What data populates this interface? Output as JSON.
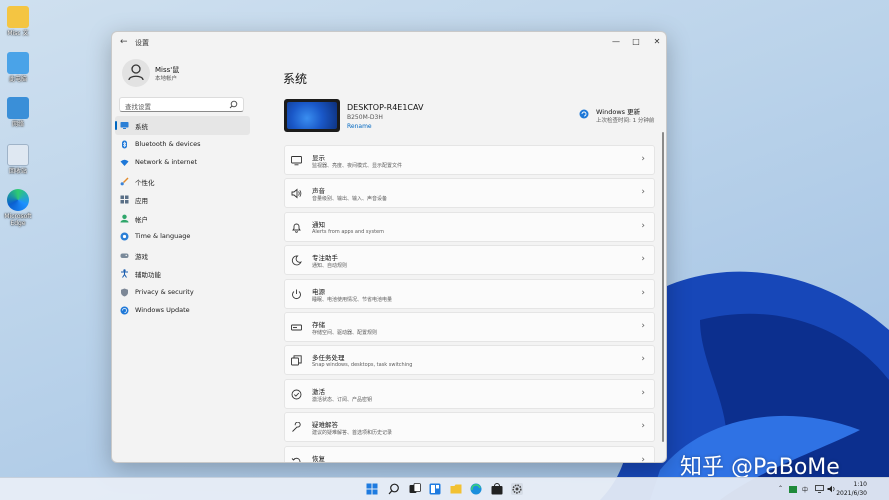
{
  "desktop": {
    "icons": [
      {
        "label": "Misc 文"
      },
      {
        "label": "此电脑"
      },
      {
        "label": "网络"
      },
      {
        "label": "回收站"
      },
      {
        "label": "Microsoft Edge"
      }
    ]
  },
  "window": {
    "title": "设置",
    "controls": {
      "minimize": "—",
      "maximize": "□",
      "close": "✕"
    }
  },
  "user": {
    "name": "Miss'鼠",
    "account_type": "本地帐户"
  },
  "search": {
    "placeholder": "查找设置"
  },
  "nav": {
    "items": [
      {
        "label": "系统",
        "icon": "monitor-icon",
        "selected": true
      },
      {
        "label": "Bluetooth & devices",
        "icon": "bluetooth-icon"
      },
      {
        "label": "Network & internet",
        "icon": "wifi-icon"
      },
      {
        "label": "个性化",
        "icon": "brush-icon"
      },
      {
        "label": "应用",
        "icon": "apps-icon"
      },
      {
        "label": "帐户",
        "icon": "person-icon"
      },
      {
        "label": "Time & language",
        "icon": "globe-icon"
      },
      {
        "label": "游戏",
        "icon": "gamepad-icon"
      },
      {
        "label": "辅助功能",
        "icon": "accessibility-icon"
      },
      {
        "label": "Privacy & security",
        "icon": "shield-icon"
      },
      {
        "label": "Windows Update",
        "icon": "update-icon"
      }
    ]
  },
  "main": {
    "title": "系统",
    "device": {
      "name": "DESKTOP-R4E1CAV",
      "model": "B250M-D3H",
      "rename_label": "Rename"
    },
    "update": {
      "title": "Windows 更新",
      "subtitle": "上次检查时间: 1 分钟前"
    },
    "cards": [
      {
        "title": "显示",
        "subtitle": "监视器、亮度、夜间模式、显示配置文件",
        "icon": "display-icon"
      },
      {
        "title": "声音",
        "subtitle": "音量级别、输出、输入、声音设备",
        "icon": "speaker-icon"
      },
      {
        "title": "通知",
        "subtitle": "Alerts from apps and system",
        "icon": "bell-icon"
      },
      {
        "title": "专注助手",
        "subtitle": "通知、自动规则",
        "icon": "moon-icon"
      },
      {
        "title": "电源",
        "subtitle": "睡眠、电池使用情况、节省电池电量",
        "icon": "power-icon"
      },
      {
        "title": "存储",
        "subtitle": "存储空间、驱动器、配置规则",
        "icon": "storage-icon"
      },
      {
        "title": "多任务处理",
        "subtitle": "Snap windows, desktops, task switching",
        "icon": "multitask-icon"
      },
      {
        "title": "激活",
        "subtitle": "激活状态、订阅、产品密钥",
        "icon": "check-circle-icon"
      },
      {
        "title": "疑难解答",
        "subtitle": "建议的疑难解答、首选项和历史记录",
        "icon": "wrench-icon"
      },
      {
        "title": "恢复",
        "subtitle": "",
        "icon": "recovery-icon"
      }
    ]
  },
  "taskbar": {
    "tray_lang": "中",
    "time": "1:10",
    "date": "2021/6/30"
  },
  "watermark": "知乎 @PaBoMe",
  "colors": {
    "accent": "#0067c0",
    "window_bg": "#f3f3f3"
  }
}
